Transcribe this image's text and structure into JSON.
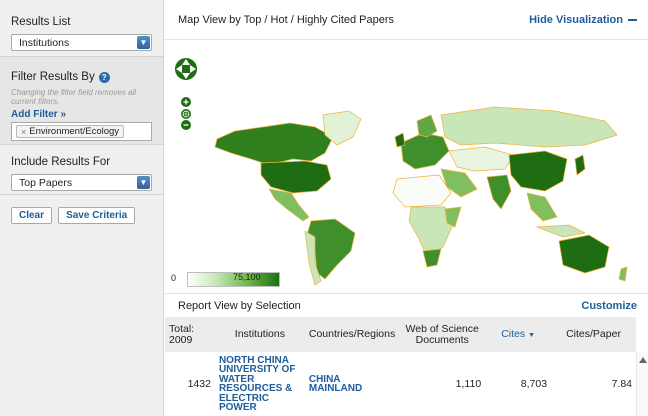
{
  "sidebar": {
    "results_list": {
      "title": "Results List",
      "selected": "Institutions"
    },
    "filter": {
      "title": "Filter Results By",
      "hint": "Changing the filter field removes all current filters.",
      "add_filter": "Add Filter »",
      "chip": "Environment/Ecology",
      "chip_remove": "×"
    },
    "include": {
      "title": "Include Results For",
      "selected": "Top Papers"
    },
    "buttons": {
      "clear": "Clear",
      "save": "Save Criteria"
    }
  },
  "map": {
    "title": "Map View by Top / Hot / Highly Cited Papers",
    "hide": "Hide Visualization",
    "legend_min": "0",
    "legend_max": "75,100",
    "colors": {
      "dark": "#1f6d12",
      "mid": "#3f8f2c",
      "light": "#7fbf5f",
      "pale": "#c9e6b8",
      "border": "#f0b23c"
    }
  },
  "report": {
    "title": "Report View by Selection",
    "customize": "Customize",
    "columns": {
      "total": "Total: 2009",
      "institutions": "Institutions",
      "countries": "Countries/Regions",
      "wos": "Web of Science Documents",
      "cites": "Cites",
      "cites_paper": "Cites/Paper"
    },
    "rows": [
      {
        "rank": "1432",
        "institution": "NORTH CHINA UNIVERSITY OF WATER RESOURCES & ELECTRIC POWER",
        "country": "CHINA MAINLAND",
        "wos": "1,110",
        "cites": "8,703",
        "cites_paper": "7.84"
      }
    ]
  }
}
